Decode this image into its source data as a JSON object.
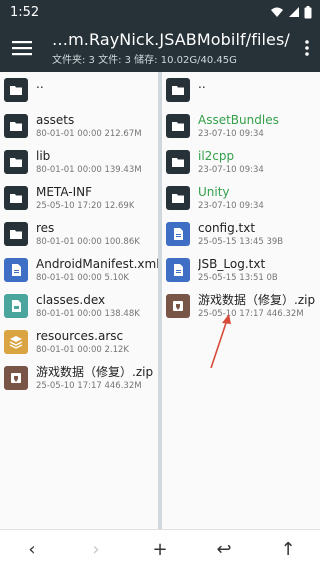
{
  "statusbar": {
    "time": "1:52",
    "icons": [
      "wifi-icon",
      "signal-icon",
      "battery-icon"
    ]
  },
  "appbar": {
    "path": "…m.RayNick.JSABMobilf/files/",
    "subtitle": "文件夹: 3  文件: 3  储存: 10.02G/40.45G"
  },
  "left_pane": {
    "items": [
      {
        "name": "..",
        "info": "",
        "type": "folder"
      },
      {
        "name": "assets",
        "info": "80-01-01 00:00  212.67M",
        "type": "folder"
      },
      {
        "name": "lib",
        "info": "80-01-01 00:00  139.43M",
        "type": "folder"
      },
      {
        "name": "META-INF",
        "info": "25-05-10 17:20  12.69K",
        "type": "folder"
      },
      {
        "name": "res",
        "info": "80-01-01 00:00  100.86K",
        "type": "folder"
      },
      {
        "name": "AndroidManifest.xml",
        "info": "80-01-01 00:00  5.10K",
        "type": "doc"
      },
      {
        "name": "classes.dex",
        "info": "80-01-01 00:00  138.48K",
        "type": "dex"
      },
      {
        "name": "resources.arsc",
        "info": "80-01-01 00:00  2.12K",
        "type": "arsc"
      },
      {
        "name": "游戏数据（修复）.zip",
        "info": "25-05-10 17:17  446.32M",
        "type": "zip"
      }
    ]
  },
  "right_pane": {
    "items": [
      {
        "name": "..",
        "info": "",
        "type": "folder"
      },
      {
        "name": "AssetBundles",
        "info": "23-07-10 09:34",
        "type": "folder",
        "green": true
      },
      {
        "name": "il2cpp",
        "info": "23-07-10 09:34",
        "type": "folder",
        "green": true
      },
      {
        "name": "Unity",
        "info": "23-07-10 09:34",
        "type": "folder",
        "green": true
      },
      {
        "name": "config.txt",
        "info": "25-05-15 13:45  39B",
        "type": "doc"
      },
      {
        "name": "JSB_Log.txt",
        "info": "25-05-15 13:51  0B",
        "type": "doc"
      },
      {
        "name": "游戏数据（修复）.zip",
        "info": "25-05-10 17:17  446.32M",
        "type": "zip"
      }
    ]
  },
  "bottombar": {
    "back": "‹",
    "forward": "›",
    "add": "+",
    "swap": "↩",
    "up": "↑"
  },
  "colors": {
    "appbar": "#263238",
    "folder_green": "#33a04a",
    "arrow": "#d84b3a"
  }
}
